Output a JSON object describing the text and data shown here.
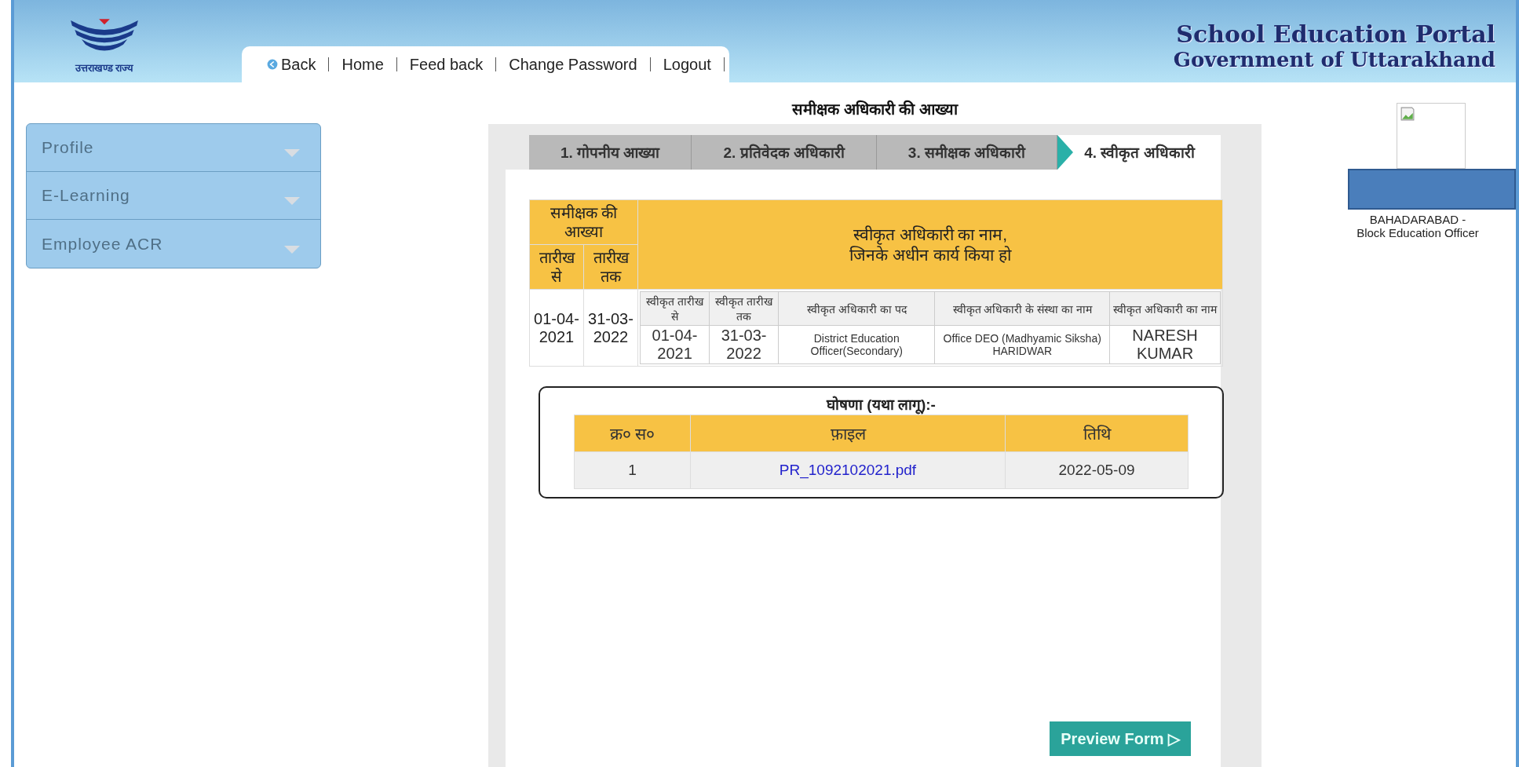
{
  "header": {
    "logo_caption": "उत्तराखण्ड राज्य",
    "title": "School Education Portal",
    "subtitle": "Government of Uttarakhand",
    "nav": [
      {
        "label": "Back",
        "kind": "back"
      },
      {
        "label": "Home",
        "kind": "link"
      },
      {
        "label": "Feed back",
        "kind": "link"
      },
      {
        "label": "Change Password",
        "kind": "link"
      },
      {
        "label": "Logout",
        "kind": "link"
      }
    ]
  },
  "sidebar": {
    "items": [
      {
        "label": "Profile",
        "expanded": false
      },
      {
        "label": "E-Learning",
        "expanded": false
      },
      {
        "label": "Employee ACR",
        "expanded": false
      }
    ]
  },
  "page_title": "समीक्षक अधिकारी की आख्या",
  "tabs": [
    {
      "label": "1. गोपनीय आख्या",
      "selected": false
    },
    {
      "label": "2. प्रतिवेदक अधिकारी",
      "selected": false
    },
    {
      "label": "3. समीक्षक अधिकारी",
      "selected": false
    },
    {
      "label": "4. स्वीकृत अधिकारी",
      "selected": true
    }
  ],
  "acr_table": {
    "period_header": "समीक्षक की आख्या",
    "from_header": "तारीख से",
    "to_header": "तारीख तक",
    "officer_header": [
      "स्वीकृत अधिकारी का नाम,",
      "जिनके अधीन कार्य किया हो"
    ],
    "from": "01-04-2021",
    "to": "31-03-2022",
    "inner_columns": [
      "स्वीकृत तारीख से",
      "स्वीकृत तारीख तक",
      "स्वीकृत अधिकारी का पद",
      "स्वीकृत अधिकारी के संस्था का नाम",
      "स्वीकृत अधिकारी का नाम"
    ],
    "inner_rows": [
      [
        "01-04-2021",
        "31-03-2022",
        "District Education Officer(Secondary)",
        "Office DEO (Madhyamic Siksha) HARIDWAR",
        "NARESH KUMAR"
      ]
    ]
  },
  "declaration": {
    "title": "घोषणा (यथा लागू):-",
    "columns": [
      "क्र० स०",
      "फ़ाइल",
      "तिथि"
    ],
    "rows": [
      {
        "sr": "1",
        "file": "PR_1092102021.pdf",
        "date": "2022-05-09"
      }
    ]
  },
  "preview_button": "Preview Form ▷",
  "profile": {
    "lines": [
      "BAHADARABAD -",
      "Block Education Officer"
    ]
  }
}
